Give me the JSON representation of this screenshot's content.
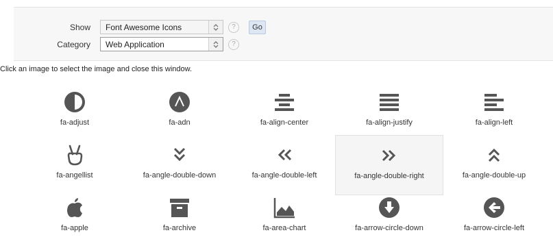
{
  "form": {
    "show_label": "Show",
    "show_value": "Font Awesome Icons",
    "category_label": "Category",
    "category_value": "Web Application",
    "go_label": "Go",
    "help_glyph": "?"
  },
  "instructions": "Click an image to select the image and close this window.",
  "icons": [
    {
      "name": "fa-adjust",
      "icon": "adjust-icon"
    },
    {
      "name": "fa-adn",
      "icon": "adn-icon"
    },
    {
      "name": "fa-align-center",
      "icon": "align-center-icon"
    },
    {
      "name": "fa-align-justify",
      "icon": "align-justify-icon"
    },
    {
      "name": "fa-align-left",
      "icon": "align-left-icon"
    },
    {
      "name": "fa-angellist",
      "icon": "angellist-icon"
    },
    {
      "name": "fa-angle-double-down",
      "icon": "angle-double-down-icon"
    },
    {
      "name": "fa-angle-double-left",
      "icon": "angle-double-left-icon"
    },
    {
      "name": "fa-angle-double-right",
      "icon": "angle-double-right-icon",
      "selected": true
    },
    {
      "name": "fa-angle-double-up",
      "icon": "angle-double-up-icon"
    },
    {
      "name": "fa-apple",
      "icon": "apple-icon"
    },
    {
      "name": "fa-archive",
      "icon": "archive-icon"
    },
    {
      "name": "fa-area-chart",
      "icon": "area-chart-icon"
    },
    {
      "name": "fa-arrow-circle-down",
      "icon": "arrow-circle-down-icon"
    },
    {
      "name": "fa-arrow-circle-left",
      "icon": "arrow-circle-left-icon"
    }
  ],
  "colors": {
    "icon": "#555555",
    "panel": "#f7f7f7",
    "go_button": "#dde7f3"
  }
}
